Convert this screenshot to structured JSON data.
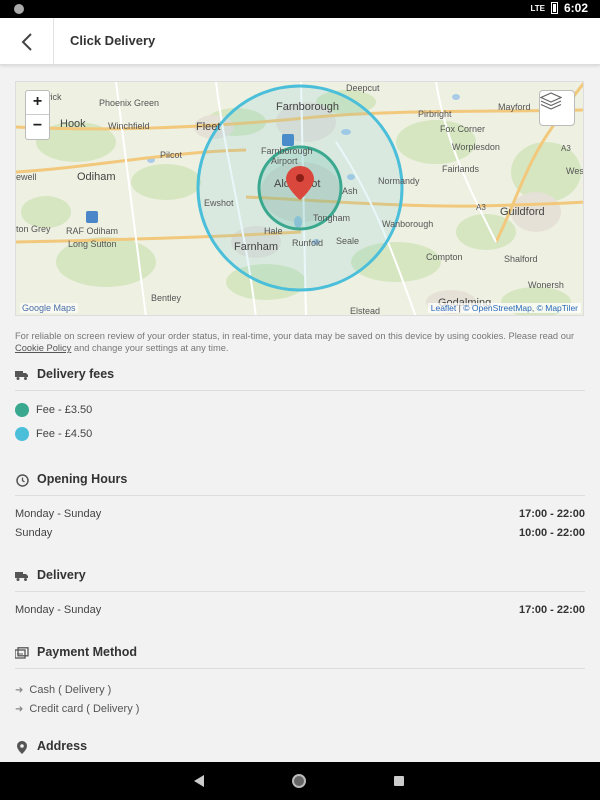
{
  "status_bar": {
    "network": "LTE",
    "time": "6:02"
  },
  "header": {
    "title": "Click Delivery",
    "back_icon": "chevron-left-icon"
  },
  "map": {
    "zoom_in": "+",
    "zoom_out": "−",
    "attribution_left": "Google Maps",
    "attribution_right_leaflet": "Leaflet",
    "attribution_right_osm": "© OpenStreetMap",
    "attribution_right_maptiler": "© MapTiler",
    "attribution_sep1": "|",
    "attribution_sep2": ",",
    "place_labels": [
      "Deepcut",
      "Farnborough",
      "Pirbright",
      "Mayford",
      "erwick",
      "Phoenix Green",
      "Hook",
      "Winchfield",
      "Fleet",
      "Fox Corner",
      "Worplesdon",
      "A3",
      "Farnborough Airport",
      "Pilcot",
      "Fairlands",
      "Odiham",
      "Aldershot",
      "Ash",
      "Normandy",
      "West",
      "ewell",
      "Ewshot",
      "A3",
      "Guildford",
      "RAF Odiham",
      "Tongham",
      "Wanborough",
      "ton Grey",
      "Hale",
      "Seale",
      "Long Sutton",
      "Farnham",
      "Runfold",
      "Compton",
      "Shalford",
      "Bentley",
      "Wonersh",
      "Elstead",
      "Godalming"
    ],
    "circle_colors": {
      "inner": "#3aa88f",
      "outer": "#4bbfd9"
    },
    "marker_color": "#d9473d"
  },
  "cookie": {
    "text_before": "For reliable on screen review of your order status, in real-time, your data may be saved on this device by using cookies. Please read our",
    "link": "Cookie Policy",
    "text_after": "and change your settings at any time."
  },
  "delivery_fees": {
    "title": "Delivery fees",
    "icon": "truck-icon",
    "items": [
      {
        "label": "Fee - £3.50",
        "color": "#3aa88f"
      },
      {
        "label": "Fee - £4.50",
        "color": "#4bbfd9"
      }
    ]
  },
  "opening_hours": {
    "title": "Opening Hours",
    "icon": "clock-icon",
    "rows": [
      {
        "day": "Monday - Sunday",
        "time": "17:00 - 22:00"
      },
      {
        "day": "Sunday",
        "time": "10:00 - 22:00"
      }
    ]
  },
  "delivery": {
    "title": "Delivery",
    "icon": "truck-icon",
    "rows": [
      {
        "day": "Monday - Sunday",
        "time": "17:00 - 22:00"
      }
    ]
  },
  "payment": {
    "title": "Payment Method",
    "icon": "money-icon",
    "items": [
      "Cash ( Delivery )",
      "Credit card ( Delivery )"
    ],
    "arrow": "➜"
  },
  "address": {
    "title": "Address",
    "icon": "map-pin-icon"
  }
}
